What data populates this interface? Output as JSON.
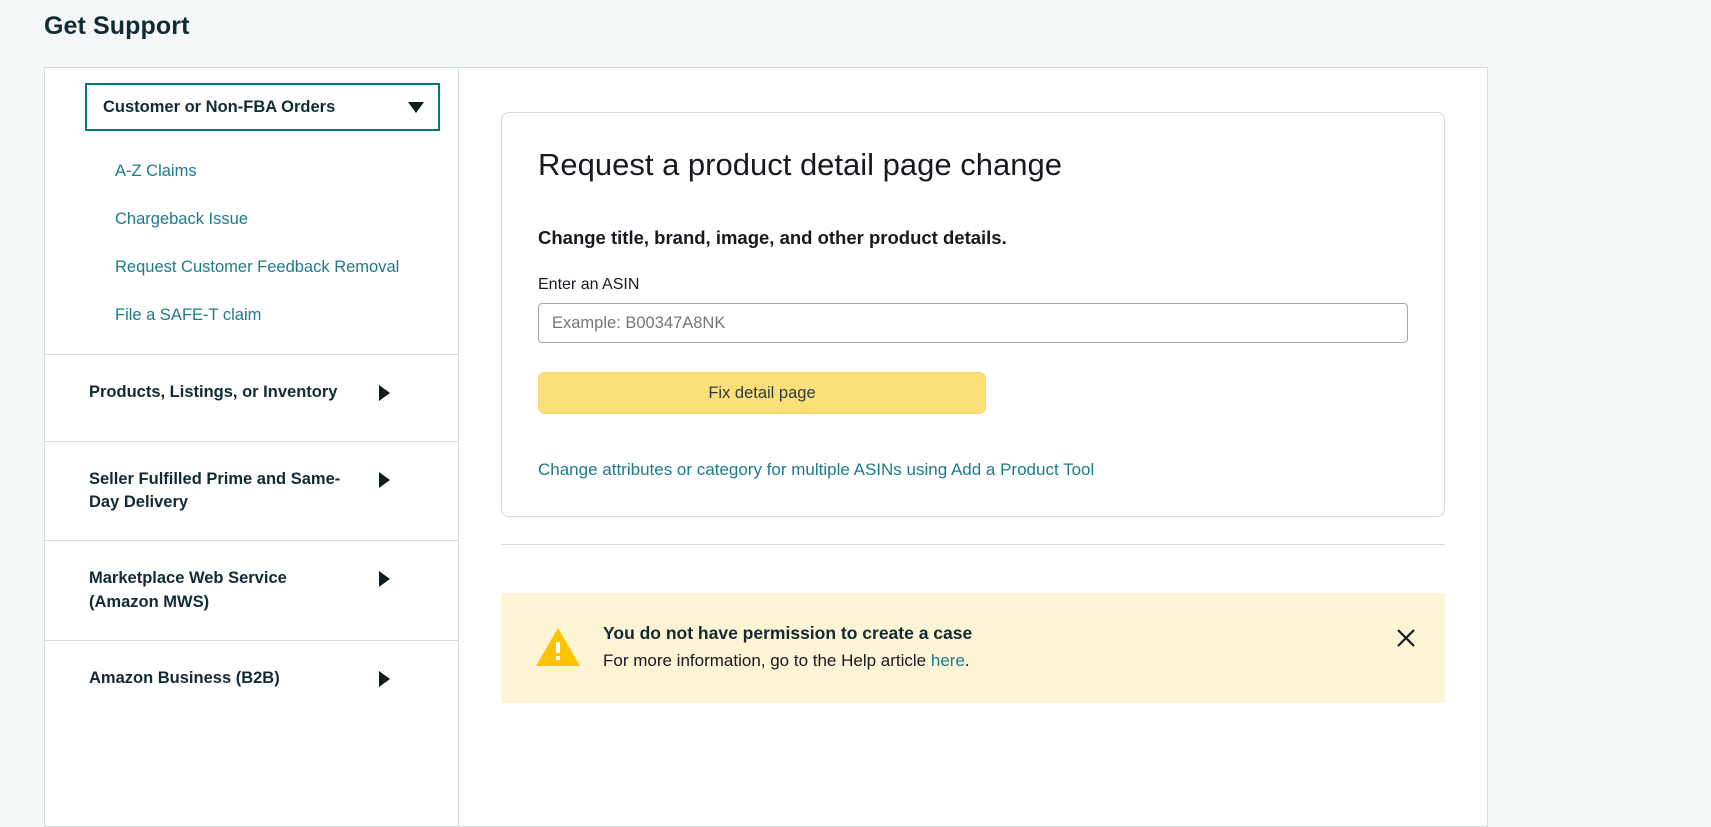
{
  "page": {
    "title": "Get Support"
  },
  "colors": {
    "background": "#f4f7f8",
    "accent_teal": "#007681",
    "link_teal": "#1b7b89",
    "button_yellow": "#fbdf79",
    "alert_background": "#fdf3d5",
    "alert_icon": "#ffc100",
    "border_grey": "#d5dbdb"
  },
  "sidebar": {
    "selected_category": {
      "label": "Customer or Non-FBA Orders",
      "icon": "chevron-down-icon",
      "expanded": true
    },
    "sub_links": [
      {
        "label": "A-Z Claims"
      },
      {
        "label": "Chargeback Issue"
      },
      {
        "label": "Request Customer Feedback Removal"
      },
      {
        "label": "File a SAFE-T claim"
      }
    ],
    "sections": [
      {
        "label": "Products, Listings, or Inventory",
        "icon": "chevron-right-icon"
      },
      {
        "label": "Seller Fulfilled Prime and Same-Day Delivery",
        "icon": "chevron-right-icon"
      },
      {
        "label": "Marketplace Web Service (Amazon MWS)",
        "icon": "chevron-right-icon"
      },
      {
        "label": "Amazon Business (B2B)",
        "icon": "chevron-right-icon"
      }
    ]
  },
  "main": {
    "card": {
      "title": "Request a product detail page change",
      "subtitle": "Change title, brand, image, and other product details.",
      "asin_field": {
        "label": "Enter an ASIN",
        "placeholder": "Example: B00347A8NK",
        "value": ""
      },
      "submit_label": "Fix detail page",
      "multi_asin_link": "Change attributes or category for multiple ASINs using Add a Product Tool"
    },
    "alert": {
      "icon": "warning-triangle-icon",
      "title": "You do not have permission to create a case",
      "text_before_link": "For more information, go to the Help article ",
      "link_label": "here",
      "text_after_link": ".",
      "close_icon": "close-icon"
    }
  }
}
